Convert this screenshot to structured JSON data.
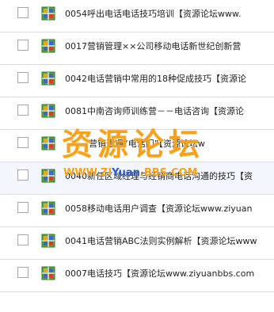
{
  "list": {
    "items": [
      {
        "label": "0054呼出电话电话技巧培训【资源论坛www.",
        "icon": "archive-file-icon"
      },
      {
        "label": "0017营销管理××公司移动电话新世纪创新营",
        "icon": "archive-file-icon"
      },
      {
        "label": "0042电话营销中常用的18种促成技巧【资源论",
        "icon": "archive-file-icon"
      },
      {
        "label": "0081中南咨询师训练营－－电话咨询【资源论",
        "icon": "archive-file-icon"
      },
      {
        "label": "营销遭遇“电话门”【资源论坛w",
        "icon": "archive-file-icon"
      },
      {
        "label": "0040新任区域经理与经销商电话沟通的技巧【资",
        "icon": "archive-file-icon",
        "hover": true
      },
      {
        "label": "0058移动电话用户调查【资源论坛www.ziyuan",
        "icon": "archive-file-icon"
      },
      {
        "label": "0041电话营销ABC法则实例解析【资源论坛www",
        "icon": "archive-file-icon"
      },
      {
        "label": "0007电话技巧【资源论坛www.ziyuanbbs.com",
        "icon": "archive-file-icon"
      }
    ]
  },
  "watermark": {
    "title": "资源论坛",
    "url_prefix": "WWW.ZI",
    "url_accent": "Yuan",
    "url_suffix": ".BBS.COM"
  },
  "colors": {
    "watermark_orange": "#f7a21a",
    "watermark_blue": "#2c58c8",
    "row_border": "#dcdcdc",
    "hover_bg": "#f3f7fd",
    "icon_green": "#5aa63a",
    "icon_orange": "#f0a21d",
    "icon_blue": "#3f67c8",
    "icon_red": "#d93b2f"
  }
}
